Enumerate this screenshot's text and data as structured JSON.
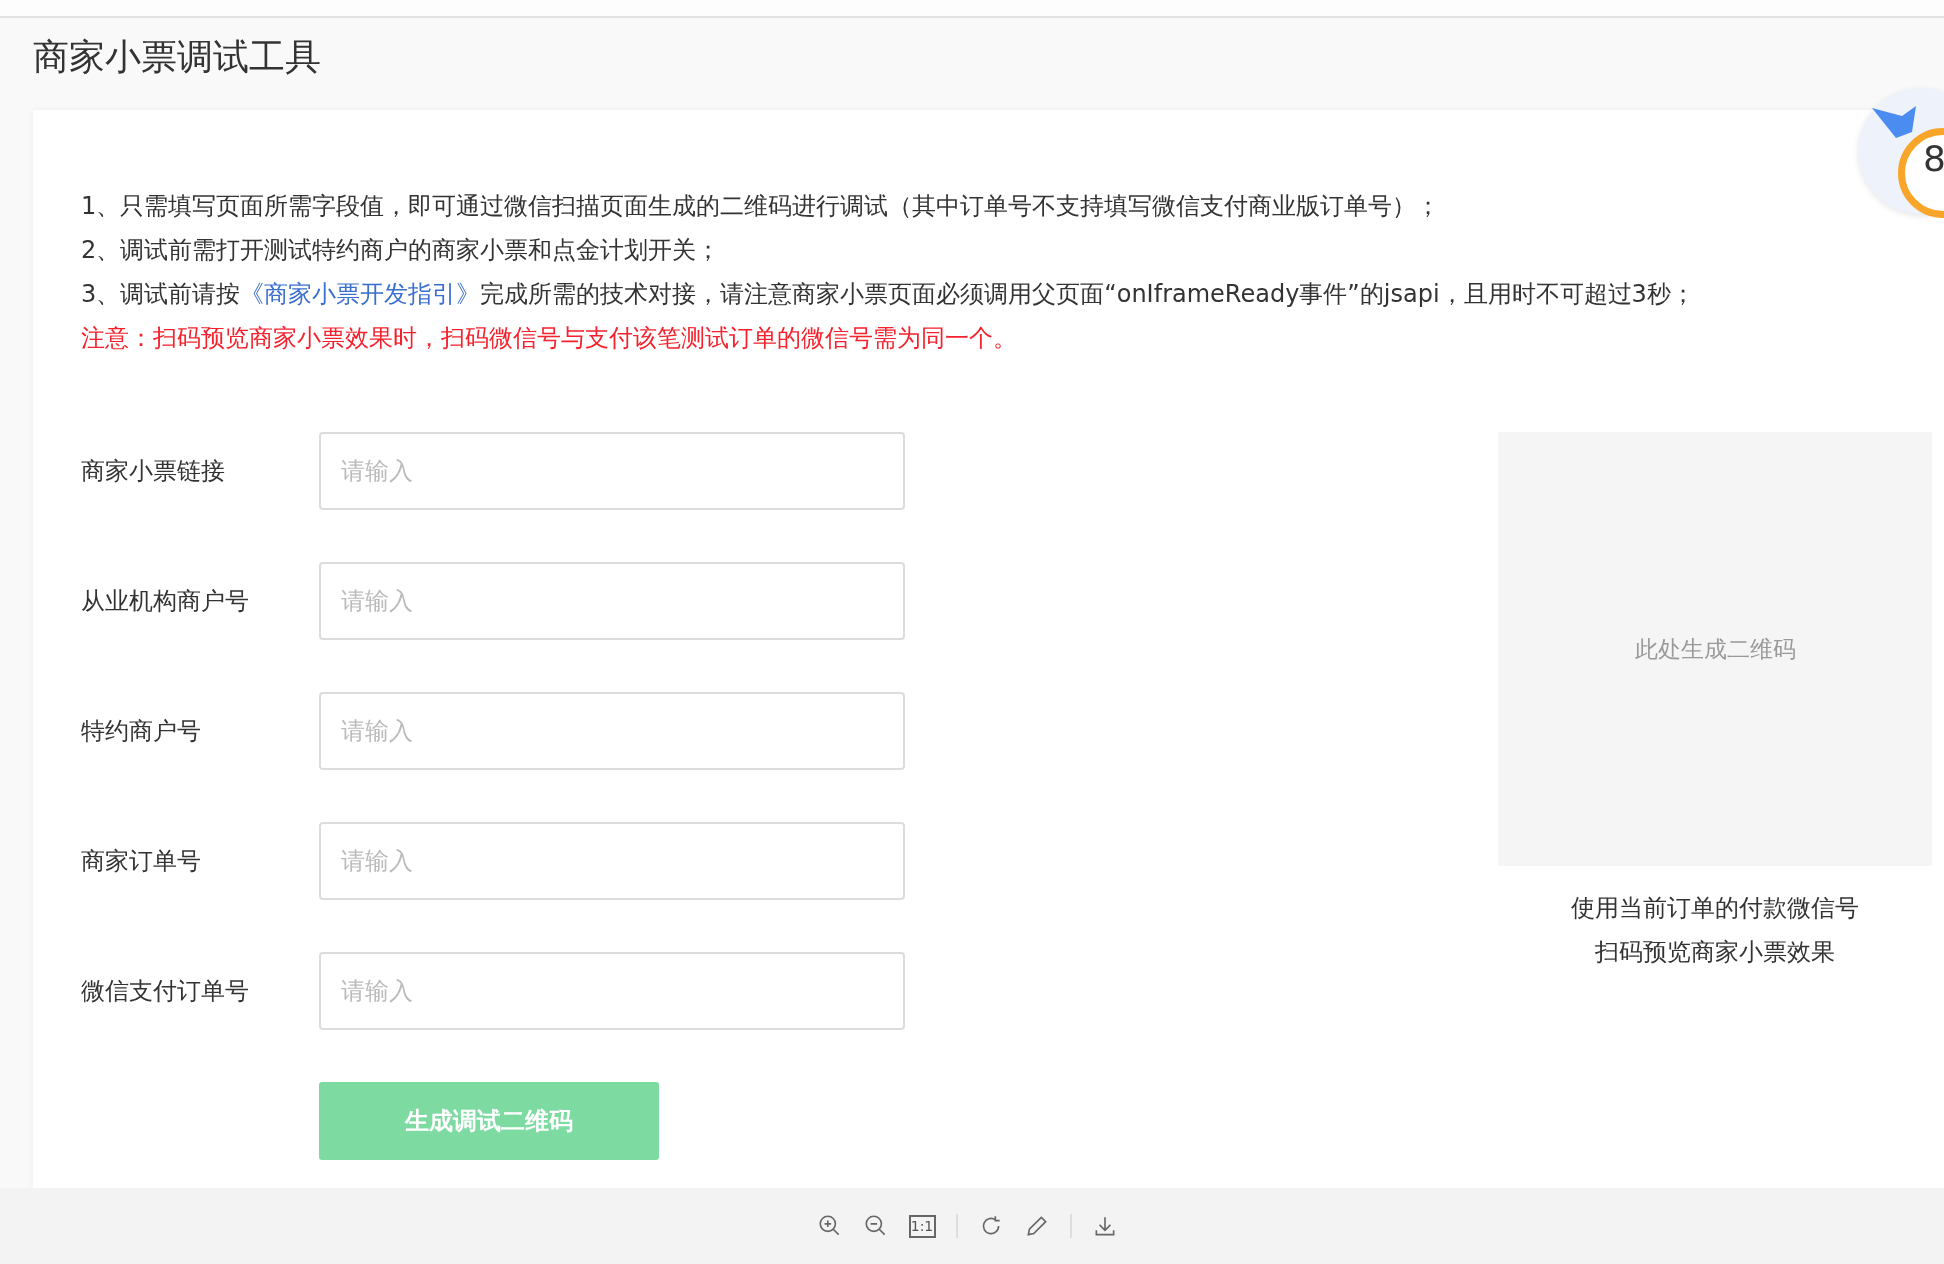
{
  "page": {
    "title": "商家小票调试工具"
  },
  "notes": [
    {
      "kind": "plain",
      "text": "1、只需填写页面所需字段值，即可通过微信扫描页面生成的二维码进行调试（其中订单号不支持填写微信支付商业版订单号）；"
    },
    {
      "kind": "plain",
      "text": "2、调试前需打开测试特约商户的商家小票和点金计划开关；"
    },
    {
      "kind": "link",
      "before": "3、调试前请按",
      "link": "《商家小票开发指引》",
      "after": "完成所需的技术对接，请注意商家小票页面必须调用父页面“onIframeReady事件”的jsapi，且用时不可超过3秒；"
    },
    {
      "kind": "warning",
      "text": "注意：扫码预览商家小票效果时，扫码微信号与支付该笔测试订单的微信号需为同一个。"
    }
  ],
  "form": {
    "fields": [
      {
        "label": "商家小票链接",
        "placeholder": "请输入"
      },
      {
        "label": "从业机构商户号",
        "placeholder": "请输入"
      },
      {
        "label": "特约商户号",
        "placeholder": "请输入"
      },
      {
        "label": "商家订单号",
        "placeholder": "请输入"
      },
      {
        "label": "微信支付订单号",
        "placeholder": "请输入"
      }
    ],
    "submit": {
      "label": "生成调试二维码",
      "disabled": true
    }
  },
  "qr": {
    "placeholder": "此处生成二维码",
    "caption": [
      "使用当前订单的付款微信号",
      "扫码预览商家小票效果"
    ]
  },
  "widget": {
    "digit": "8"
  },
  "viewer_toolbar": {
    "actual_size": "1:1"
  }
}
